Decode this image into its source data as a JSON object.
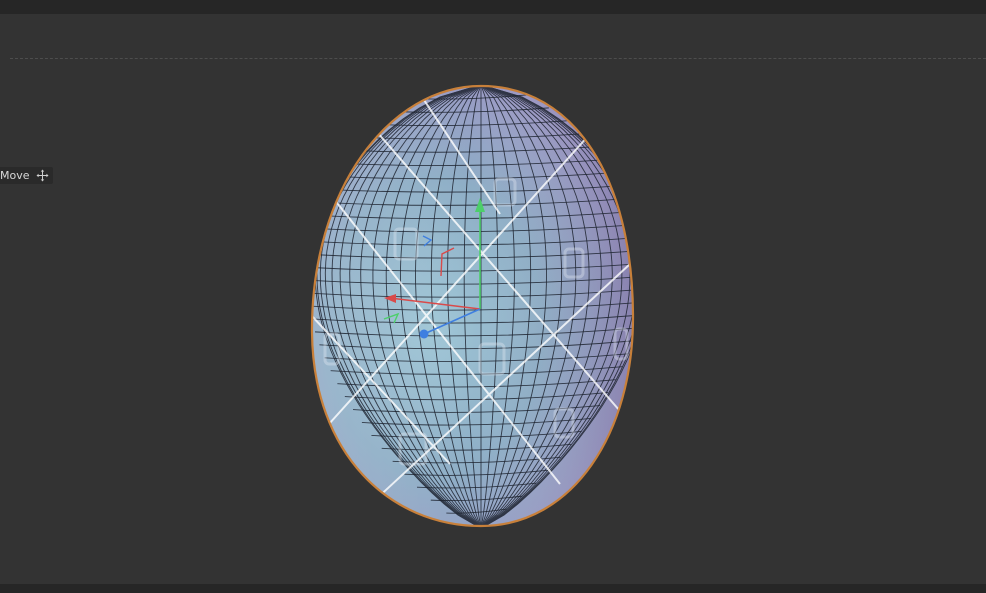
{
  "window": {
    "active_tool": "Move"
  },
  "toolbar": {
    "move_tool_label": "Move",
    "move_tool_icon": "move-cross-icon"
  },
  "viewport": {
    "object": "egg-mesh",
    "selection_outline_color": "#c8803a",
    "background_color": "#333333",
    "gizmo": {
      "x_axis_color": "#d94a4a",
      "y_axis_color": "#4ccf6a",
      "z_axis_color": "#3f7fe0"
    }
  }
}
